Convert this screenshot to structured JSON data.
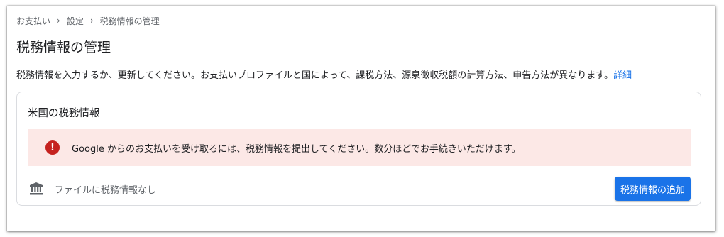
{
  "breadcrumb": {
    "items": [
      "お支払い",
      "設定",
      "税務情報の管理"
    ]
  },
  "page": {
    "title": "税務情報の管理",
    "description": "税務情報を入力するか、更新してください。お支払いプロファイルと国によって、課税方法、源泉徴収税額の計算方法、申告方法が異なります。",
    "details_link": "詳細"
  },
  "card": {
    "title": "米国の税務情報",
    "alert": {
      "icon": "error-icon",
      "text": "Google からのお支払いを受け取るには、税務情報を提出してください。数分ほどでお手続きいただけます。"
    },
    "status": {
      "icon": "bank-icon",
      "text": "ファイルに税務情報なし"
    },
    "add_button": "税務情報の追加"
  },
  "colors": {
    "accent": "#1a73e8",
    "alert_bg": "#fce8e6",
    "alert_icon": "#c5221f"
  }
}
